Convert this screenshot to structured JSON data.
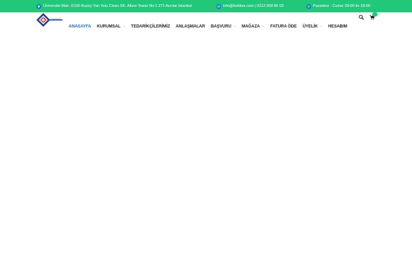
{
  "topbar": {
    "address": "Üniversite Mah. D100 Kuzey Yan Yolu Civarı SK. Allure Tower No:1 271 Avcılar İstanbul",
    "contact": "info@kobitsa.com | 0212 909 86 03",
    "hours": "Pazartesi - Cuma: 09:00 ile 18:00",
    "background_color": "#21c87a",
    "icon_color": "#1476c8"
  },
  "header": {
    "logo_icon": "diamond-logo-icon",
    "nav": [
      {
        "label": "ANASAYFA",
        "active": true,
        "dropdown": false
      },
      {
        "label": "KURUMSAL",
        "active": false,
        "dropdown": true
      },
      {
        "label": "TEDARİKÇİLERİMİZ",
        "active": false,
        "dropdown": false
      },
      {
        "label": "ANLAŞMALAR",
        "active": false,
        "dropdown": false
      },
      {
        "label": "BAŞVURU",
        "active": false,
        "dropdown": true
      },
      {
        "label": "MAĞAZA",
        "active": false,
        "dropdown": true
      },
      {
        "label": "FATURA ÖDE",
        "active": false,
        "dropdown": false
      },
      {
        "label": "ÜYELİK",
        "active": false,
        "dropdown": true
      },
      {
        "label": "HESABIM",
        "active": false,
        "dropdown": false
      }
    ],
    "caret_glyph": "⌄",
    "search_icon": "search-icon",
    "cart_icon": "cart-icon",
    "cart_count": "",
    "active_color": "#1e6ab0"
  }
}
